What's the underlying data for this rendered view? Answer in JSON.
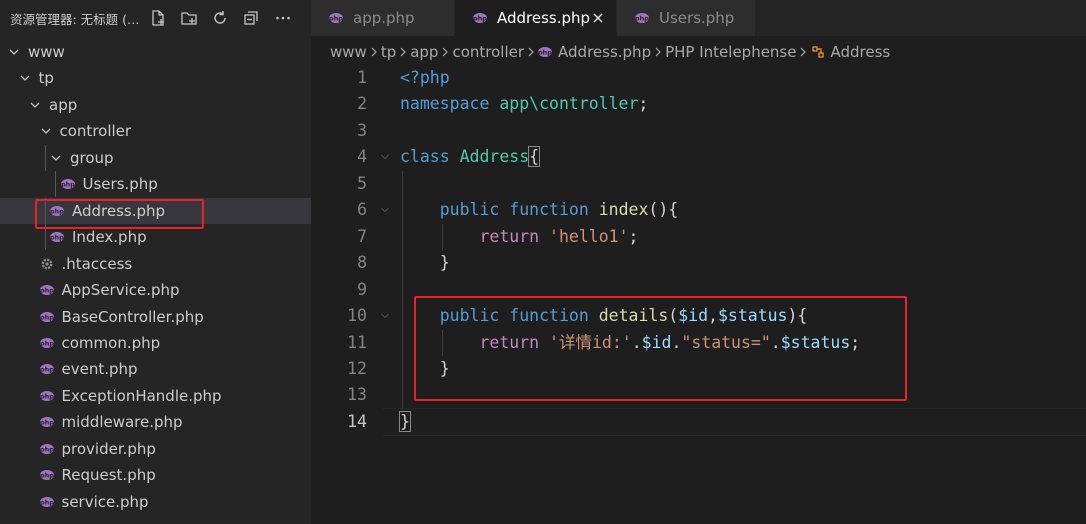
{
  "explorer": {
    "title": "资源管理器: 无标题 (…",
    "actions": [
      "new-file-icon",
      "new-folder-icon",
      "refresh-icon",
      "collapse-all-icon",
      "more-icon"
    ],
    "tree": [
      {
        "label": "www",
        "kind": "folder",
        "depth": 0
      },
      {
        "label": "tp",
        "kind": "folder",
        "depth": 1
      },
      {
        "label": "app",
        "kind": "folder",
        "depth": 2
      },
      {
        "label": "controller",
        "kind": "folder",
        "depth": 3
      },
      {
        "label": "group",
        "kind": "folder",
        "depth": 4
      },
      {
        "label": "Users.php",
        "kind": "php",
        "depth": 5
      },
      {
        "label": "Address.php",
        "kind": "php",
        "depth": 4,
        "selected": true
      },
      {
        "label": "Index.php",
        "kind": "php",
        "depth": 4
      },
      {
        "label": ".htaccess",
        "kind": "config",
        "depth": 3
      },
      {
        "label": "AppService.php",
        "kind": "php",
        "depth": 3
      },
      {
        "label": "BaseController.php",
        "kind": "php",
        "depth": 3
      },
      {
        "label": "common.php",
        "kind": "php",
        "depth": 3
      },
      {
        "label": "event.php",
        "kind": "php",
        "depth": 3
      },
      {
        "label": "ExceptionHandle.php",
        "kind": "php",
        "depth": 3
      },
      {
        "label": "middleware.php",
        "kind": "php",
        "depth": 3
      },
      {
        "label": "provider.php",
        "kind": "php",
        "depth": 3
      },
      {
        "label": "Request.php",
        "kind": "php",
        "depth": 3
      },
      {
        "label": "service.php",
        "kind": "php",
        "depth": 3
      }
    ]
  },
  "tabs": [
    {
      "label": "app.php",
      "active": false
    },
    {
      "label": "Address.php",
      "active": true
    },
    {
      "label": "Users.php",
      "active": false
    }
  ],
  "breadcrumb": [
    "www",
    "tp",
    "app",
    "controller",
    "Address.php",
    "PHP Intelephense",
    "Address"
  ],
  "code": {
    "current_line": 14,
    "lines": [
      {
        "n": "1",
        "tokens": [
          [
            "kw-blue",
            "<?php"
          ]
        ]
      },
      {
        "n": "2",
        "tokens": [
          [
            "kw-blue",
            "namespace"
          ],
          [
            "plain",
            " "
          ],
          [
            "cls",
            "app\\controller"
          ],
          [
            "plain",
            ";"
          ]
        ]
      },
      {
        "n": "3",
        "tokens": []
      },
      {
        "n": "4",
        "tokens": [
          [
            "kw-blue",
            "class"
          ],
          [
            "plain",
            " "
          ],
          [
            "cls",
            "Address"
          ],
          [
            "plain",
            "{"
          ]
        ]
      },
      {
        "n": "5",
        "tokens": []
      },
      {
        "n": "6",
        "tokens": [
          [
            "plain",
            "    "
          ],
          [
            "kw-blue",
            "public"
          ],
          [
            "plain",
            " "
          ],
          [
            "kw-blue",
            "function"
          ],
          [
            "plain",
            " "
          ],
          [
            "fn",
            "index"
          ],
          [
            "plain",
            "(){"
          ]
        ]
      },
      {
        "n": "7",
        "tokens": [
          [
            "plain",
            "        "
          ],
          [
            "kw-purple",
            "return"
          ],
          [
            "plain",
            " "
          ],
          [
            "str",
            "'hello1'"
          ],
          [
            "plain",
            ";"
          ]
        ]
      },
      {
        "n": "8",
        "tokens": [
          [
            "plain",
            "    }"
          ]
        ]
      },
      {
        "n": "9",
        "tokens": []
      },
      {
        "n": "10",
        "tokens": [
          [
            "plain",
            "    "
          ],
          [
            "kw-blue",
            "public"
          ],
          [
            "plain",
            " "
          ],
          [
            "kw-blue",
            "function"
          ],
          [
            "plain",
            " "
          ],
          [
            "fn",
            "details"
          ],
          [
            "plain",
            "("
          ],
          [
            "var",
            "$id"
          ],
          [
            "plain",
            ","
          ],
          [
            "var",
            "$status"
          ],
          [
            "plain",
            "){"
          ]
        ]
      },
      {
        "n": "11",
        "tokens": [
          [
            "plain",
            "        "
          ],
          [
            "kw-purple",
            "return"
          ],
          [
            "plain",
            " "
          ],
          [
            "str",
            "'详情id:'"
          ],
          [
            "plain",
            "."
          ],
          [
            "var",
            "$id"
          ],
          [
            "plain",
            "."
          ],
          [
            "str",
            "\"status=\""
          ],
          [
            "plain",
            "."
          ],
          [
            "var",
            "$status"
          ],
          [
            "plain",
            ";"
          ]
        ]
      },
      {
        "n": "12",
        "tokens": [
          [
            "plain",
            "    }"
          ]
        ]
      },
      {
        "n": "13",
        "tokens": []
      },
      {
        "n": "14",
        "tokens": [
          [
            "plain",
            "}"
          ]
        ]
      }
    ]
  },
  "colors": {
    "highlight_box": "#e5232a",
    "php_icon": "#a074c4",
    "selected_row": "#37373d"
  }
}
